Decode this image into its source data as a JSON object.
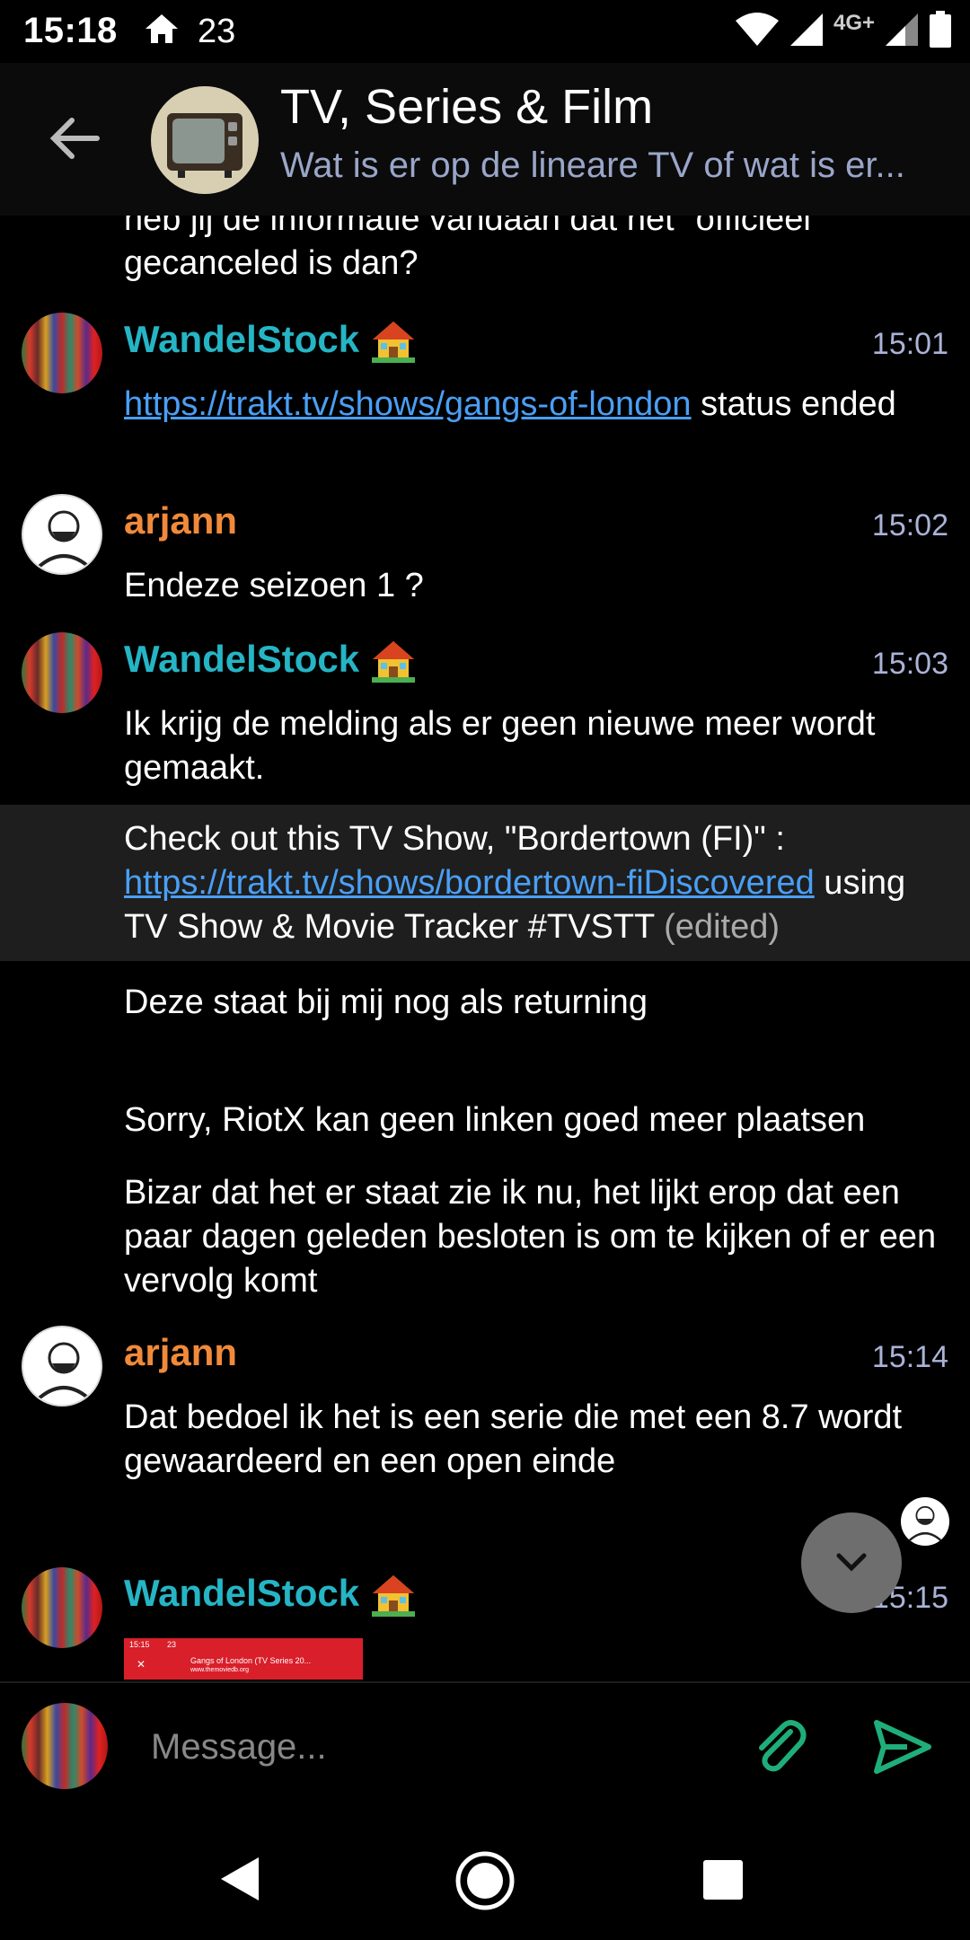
{
  "status_bar": {
    "time": "15:18",
    "temperature": "23",
    "network": "4G+"
  },
  "room": {
    "title": "TV, Series &  Film",
    "topic": "Wat is er op de lineare TV of wat is er..."
  },
  "messages": [
    {
      "text": "heb jij de informatie vandaan dat het \"officieel\" gecanceled is dan?"
    },
    {
      "sender": "WandelStock",
      "time": "15:01",
      "link": "https://trakt.tv/shows/gangs-of-london",
      "text": " status ended"
    },
    {
      "sender": "arjann",
      "time": "15:02",
      "text": "Endeze seizoen 1 ?"
    },
    {
      "sender": "WandelStock",
      "time": "15:03",
      "text": "Ik krijg de melding als er geen nieuwe meer wordt gemaakt."
    },
    {
      "text_before": "Check out this TV Show, \"Bordertown (FI)\" : ",
      "link": "https://trakt.tv/shows/bordertown-fiDiscovered",
      "text_after": " using TV Show & Movie Tracker #TVSTT",
      "edited": "(edited)"
    },
    {
      "text": "Deze staat bij mij nog als returning"
    },
    {
      "text": "Sorry, RiotX kan geen linken goed meer plaatsen"
    },
    {
      "text": "Bizar dat het er staat zie ik nu, het lijkt erop dat een paar dagen geleden besloten is om te kijken of er een vervolg komt"
    },
    {
      "sender": "arjann",
      "time": "15:14",
      "text": "Dat bedoel ik het is een serie die met een 8.7 wordt gewaardeerd en een open einde"
    },
    {
      "sender": "WandelStock",
      "time": "15:15",
      "thumbnail_title": "Gangs of London (TV Series 20...",
      "thumbnail_url": "www.themoviedb.org",
      "thumbnail_time": "15:15",
      "thumbnail_temp": "23"
    }
  ],
  "composer": {
    "placeholder": "Message..."
  },
  "colors": {
    "username_wandelstock": "#25b5c5",
    "username_arjann": "#f08a3a",
    "accent": "#1fae7a",
    "link": "#4a9ff5"
  }
}
